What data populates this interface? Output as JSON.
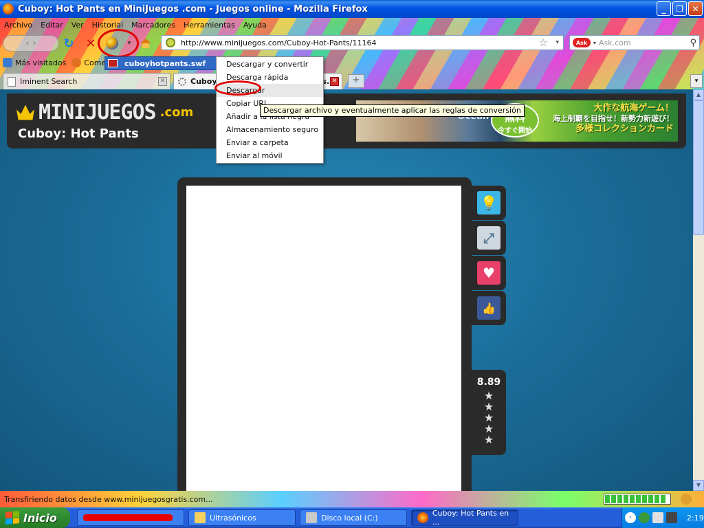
{
  "window": {
    "title": "Cuboy: Hot Pants en MiniJuegos .com - Juegos online - Mozilla Firefox",
    "min_glyph": "_",
    "max_glyph": "❐",
    "close_glyph": "✕"
  },
  "menubar": {
    "items": [
      "Archivo",
      "Editar",
      "Ver",
      "Historial",
      "Marcadores",
      "Herramientas",
      "Ayuda"
    ]
  },
  "navbar": {
    "back_glyph": "‹ ›",
    "reload_glyph": "↻",
    "stop_glyph": "✕",
    "url": "http://www.minijuegos.com/Cuboy-Hot-Pants/11164",
    "star_glyph": "☆",
    "dropdown_glyph": "▾",
    "search_placeholder": "Ask.com",
    "search_engine_label": "Ask",
    "search_glyph": "⚲"
  },
  "bookmarks": {
    "items": [
      {
        "label": "Más visitados",
        "icon": "bookmark-icon"
      },
      {
        "label": "Comen...",
        "icon": "firefox-icon"
      }
    ]
  },
  "tabs": {
    "items": [
      {
        "label": "Iminent Search",
        "active": false
      },
      {
        "label": "Cuboy: Hot Pants en MiniJuegos...",
        "active": true
      }
    ],
    "new_tab_glyph": "+",
    "close_glyph": "✕",
    "list_glyph": "▾"
  },
  "extension_menu": {
    "file_label": "cuboyhotpants.swf",
    "items": [
      "Descargar y convertir",
      "Descarga rápida",
      "Descargar",
      "Copiar URL",
      "Añadir a la lista negra",
      "Almacenamiento seguro",
      "Enviar a carpeta",
      "Enviar al móvil"
    ],
    "hovered_index": 2,
    "tooltip": "Descargar archivo y eventualmente aplicar las reglas de conversión"
  },
  "page": {
    "logo_text": "MINIJUEGOS",
    "logo_suffix": ".com",
    "game_title": "Cuboy: Hot Pants",
    "banner": {
      "ocean": "Ocean",
      "badge_big": "無料",
      "badge_small": "今すぐ開始",
      "line1": "大作な航海ゲーム！",
      "line2": "海上制覇を目指せ！新勢力新遊び！",
      "line3": "多様コレクションカード"
    },
    "side_buttons": [
      {
        "name": "lightbulb",
        "glyph": "💡",
        "color": "#3bb6e6"
      },
      {
        "name": "fullscreen",
        "glyph": "⤢",
        "color": "#cfd8e0"
      },
      {
        "name": "favorite",
        "glyph": "♥",
        "color": "#e8406a"
      },
      {
        "name": "like",
        "glyph": "👍",
        "color": "#3b5998"
      }
    ],
    "rating": {
      "score": "8.89",
      "stars": [
        "★",
        "★",
        "★",
        "★",
        "★"
      ]
    }
  },
  "status": {
    "text": "Transfiriendo datos desde www.minijuegosgratis.com...",
    "progress": 1.0
  },
  "taskbar": {
    "start_label": "Inicio",
    "tasks": [
      {
        "label": "",
        "redacted": true,
        "active": false
      },
      {
        "label": "Ultrasónicos",
        "active": false
      },
      {
        "label": "Disco local (C:)",
        "active": false
      },
      {
        "label": "Cuboy: Hot Pants en ...",
        "active": true
      }
    ],
    "clock": "2:19"
  },
  "colors": {
    "xp_blue": "#0054e3",
    "menu_highlight": "#316ac5",
    "annotation_red": "#e00000",
    "page_blue": "#1b6e9a",
    "header_dark": "#2a2a2a",
    "logo_gold": "#f5c400"
  }
}
